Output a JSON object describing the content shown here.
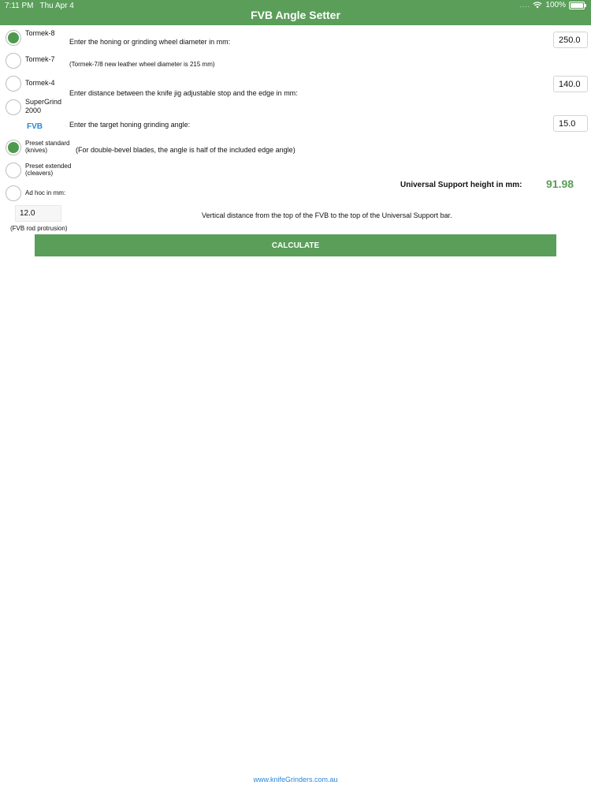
{
  "status_bar": {
    "time": "7:11 PM",
    "date": "Thu Apr 4",
    "signal": "....",
    "battery": "100%"
  },
  "header": {
    "title": "FVB Angle Setter"
  },
  "machines": [
    {
      "label": "Tormek-8",
      "selected": true
    },
    {
      "label": "Tormek-7",
      "selected": false
    },
    {
      "label": "Tormek-4",
      "selected": false
    },
    {
      "label": "SuperGrind\n2000",
      "selected": false
    }
  ],
  "fvb": {
    "heading": "FVB",
    "options": [
      {
        "label": "Preset standard\n(knives)",
        "selected": true
      },
      {
        "label": "Preset extended\n(cleavers)",
        "selected": false
      },
      {
        "label": "Ad hoc in mm:",
        "selected": false
      }
    ],
    "adhoc_value": "12.0",
    "adhoc_caption": "(FVB rod protrusion)"
  },
  "inputs": {
    "wheel_diameter_label": "Enter the honing or grinding wheel diameter in mm:",
    "wheel_diameter_note": "(Tormek-7/8 new leather wheel diameter is 215 mm)",
    "wheel_diameter_value": "250.0",
    "distance_label": "Enter distance between the knife jig adjustable stop and the edge in mm:",
    "distance_value": "140.0",
    "angle_label": "Enter the target honing grinding angle:",
    "angle_note": "(For double-bevel blades, the angle is half of the included edge angle)",
    "angle_value": "15.0"
  },
  "result": {
    "label": "Universal Support height in mm:",
    "value": "91.98",
    "description": "Vertical distance from the top of the FVB to the top of the Universal Support bar."
  },
  "actions": {
    "calculate_label": "CALCULATE"
  },
  "footer": {
    "link_text": "www.knifeGrinders.com.au"
  },
  "colors": {
    "brand_green": "#5a9e5a",
    "radio_green": "#4e9a4e",
    "link_blue": "#2a86d8"
  }
}
